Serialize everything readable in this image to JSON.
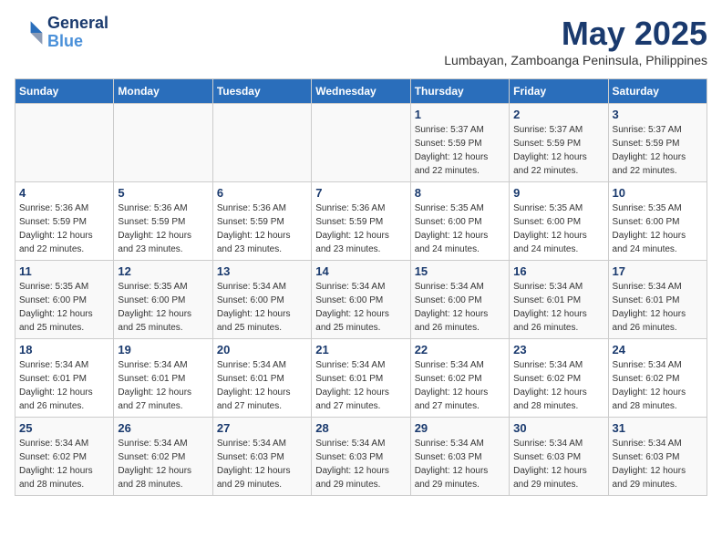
{
  "logo": {
    "line1": "General",
    "line2": "Blue"
  },
  "title": "May 2025",
  "subtitle": "Lumbayan, Zamboanga Peninsula, Philippines",
  "days_header": [
    "Sunday",
    "Monday",
    "Tuesday",
    "Wednesday",
    "Thursday",
    "Friday",
    "Saturday"
  ],
  "weeks": [
    [
      {
        "day": "",
        "info": ""
      },
      {
        "day": "",
        "info": ""
      },
      {
        "day": "",
        "info": ""
      },
      {
        "day": "",
        "info": ""
      },
      {
        "day": "1",
        "info": "Sunrise: 5:37 AM\nSunset: 5:59 PM\nDaylight: 12 hours and 22 minutes."
      },
      {
        "day": "2",
        "info": "Sunrise: 5:37 AM\nSunset: 5:59 PM\nDaylight: 12 hours and 22 minutes."
      },
      {
        "day": "3",
        "info": "Sunrise: 5:37 AM\nSunset: 5:59 PM\nDaylight: 12 hours and 22 minutes."
      }
    ],
    [
      {
        "day": "4",
        "info": "Sunrise: 5:36 AM\nSunset: 5:59 PM\nDaylight: 12 hours and 22 minutes."
      },
      {
        "day": "5",
        "info": "Sunrise: 5:36 AM\nSunset: 5:59 PM\nDaylight: 12 hours and 23 minutes."
      },
      {
        "day": "6",
        "info": "Sunrise: 5:36 AM\nSunset: 5:59 PM\nDaylight: 12 hours and 23 minutes."
      },
      {
        "day": "7",
        "info": "Sunrise: 5:36 AM\nSunset: 5:59 PM\nDaylight: 12 hours and 23 minutes."
      },
      {
        "day": "8",
        "info": "Sunrise: 5:35 AM\nSunset: 6:00 PM\nDaylight: 12 hours and 24 minutes."
      },
      {
        "day": "9",
        "info": "Sunrise: 5:35 AM\nSunset: 6:00 PM\nDaylight: 12 hours and 24 minutes."
      },
      {
        "day": "10",
        "info": "Sunrise: 5:35 AM\nSunset: 6:00 PM\nDaylight: 12 hours and 24 minutes."
      }
    ],
    [
      {
        "day": "11",
        "info": "Sunrise: 5:35 AM\nSunset: 6:00 PM\nDaylight: 12 hours and 25 minutes."
      },
      {
        "day": "12",
        "info": "Sunrise: 5:35 AM\nSunset: 6:00 PM\nDaylight: 12 hours and 25 minutes."
      },
      {
        "day": "13",
        "info": "Sunrise: 5:34 AM\nSunset: 6:00 PM\nDaylight: 12 hours and 25 minutes."
      },
      {
        "day": "14",
        "info": "Sunrise: 5:34 AM\nSunset: 6:00 PM\nDaylight: 12 hours and 25 minutes."
      },
      {
        "day": "15",
        "info": "Sunrise: 5:34 AM\nSunset: 6:00 PM\nDaylight: 12 hours and 26 minutes."
      },
      {
        "day": "16",
        "info": "Sunrise: 5:34 AM\nSunset: 6:01 PM\nDaylight: 12 hours and 26 minutes."
      },
      {
        "day": "17",
        "info": "Sunrise: 5:34 AM\nSunset: 6:01 PM\nDaylight: 12 hours and 26 minutes."
      }
    ],
    [
      {
        "day": "18",
        "info": "Sunrise: 5:34 AM\nSunset: 6:01 PM\nDaylight: 12 hours and 26 minutes."
      },
      {
        "day": "19",
        "info": "Sunrise: 5:34 AM\nSunset: 6:01 PM\nDaylight: 12 hours and 27 minutes."
      },
      {
        "day": "20",
        "info": "Sunrise: 5:34 AM\nSunset: 6:01 PM\nDaylight: 12 hours and 27 minutes."
      },
      {
        "day": "21",
        "info": "Sunrise: 5:34 AM\nSunset: 6:01 PM\nDaylight: 12 hours and 27 minutes."
      },
      {
        "day": "22",
        "info": "Sunrise: 5:34 AM\nSunset: 6:02 PM\nDaylight: 12 hours and 27 minutes."
      },
      {
        "day": "23",
        "info": "Sunrise: 5:34 AM\nSunset: 6:02 PM\nDaylight: 12 hours and 28 minutes."
      },
      {
        "day": "24",
        "info": "Sunrise: 5:34 AM\nSunset: 6:02 PM\nDaylight: 12 hours and 28 minutes."
      }
    ],
    [
      {
        "day": "25",
        "info": "Sunrise: 5:34 AM\nSunset: 6:02 PM\nDaylight: 12 hours and 28 minutes."
      },
      {
        "day": "26",
        "info": "Sunrise: 5:34 AM\nSunset: 6:02 PM\nDaylight: 12 hours and 28 minutes."
      },
      {
        "day": "27",
        "info": "Sunrise: 5:34 AM\nSunset: 6:03 PM\nDaylight: 12 hours and 29 minutes."
      },
      {
        "day": "28",
        "info": "Sunrise: 5:34 AM\nSunset: 6:03 PM\nDaylight: 12 hours and 29 minutes."
      },
      {
        "day": "29",
        "info": "Sunrise: 5:34 AM\nSunset: 6:03 PM\nDaylight: 12 hours and 29 minutes."
      },
      {
        "day": "30",
        "info": "Sunrise: 5:34 AM\nSunset: 6:03 PM\nDaylight: 12 hours and 29 minutes."
      },
      {
        "day": "31",
        "info": "Sunrise: 5:34 AM\nSunset: 6:03 PM\nDaylight: 12 hours and 29 minutes."
      }
    ]
  ]
}
